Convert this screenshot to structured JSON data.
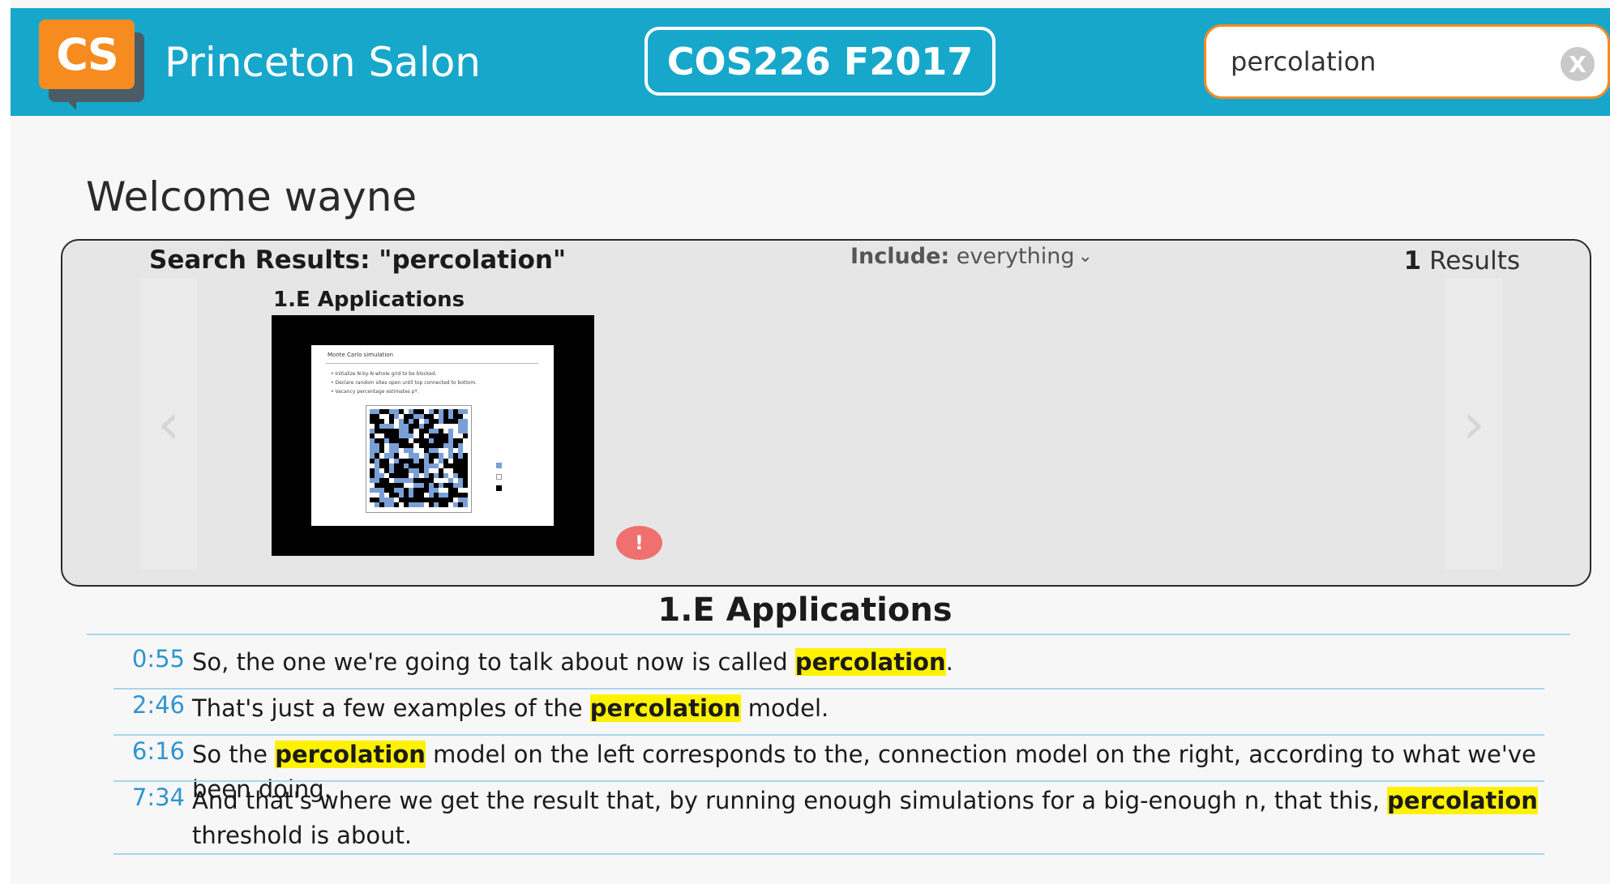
{
  "header": {
    "logo_text": "CS",
    "site_title": "Princeton Salon",
    "course_label": "COS226 F2017",
    "search": {
      "value": "percolation",
      "clear_label": "X"
    }
  },
  "welcome": "Welcome wayne",
  "results": {
    "title": "Search Results: \"percolation\"",
    "include_label": "Include:",
    "include_value": "everything",
    "count": "1",
    "count_label": "Results",
    "card": {
      "title": "1.E Applications",
      "alert": "!"
    }
  },
  "transcript": {
    "title": "1.E Applications",
    "highlight_term": "percolation",
    "entries": [
      {
        "time": "0:55",
        "before": "So, the one we're going to talk about now is called ",
        "term": "percolation",
        "after": "."
      },
      {
        "time": "2:46",
        "before": "That's just a few examples of the ",
        "term": "percolation",
        "after": " model."
      },
      {
        "time": "6:16",
        "before": "So the ",
        "term": "percolation",
        "after": " model on the left corresponds to the, connection model on the right, according to what we've been doing."
      },
      {
        "time": "7:34",
        "before": "And that's where we get the result that, by running enough simulations for a big-enough n, that this, ",
        "term": "percolation",
        "after": " threshold is about."
      }
    ]
  },
  "colors": {
    "header_bg": "#17a7cb",
    "logo_orange": "#f68b1f",
    "timestamp_blue": "#2f95cf",
    "highlight": "#fff200",
    "alert_red": "#f07070"
  }
}
